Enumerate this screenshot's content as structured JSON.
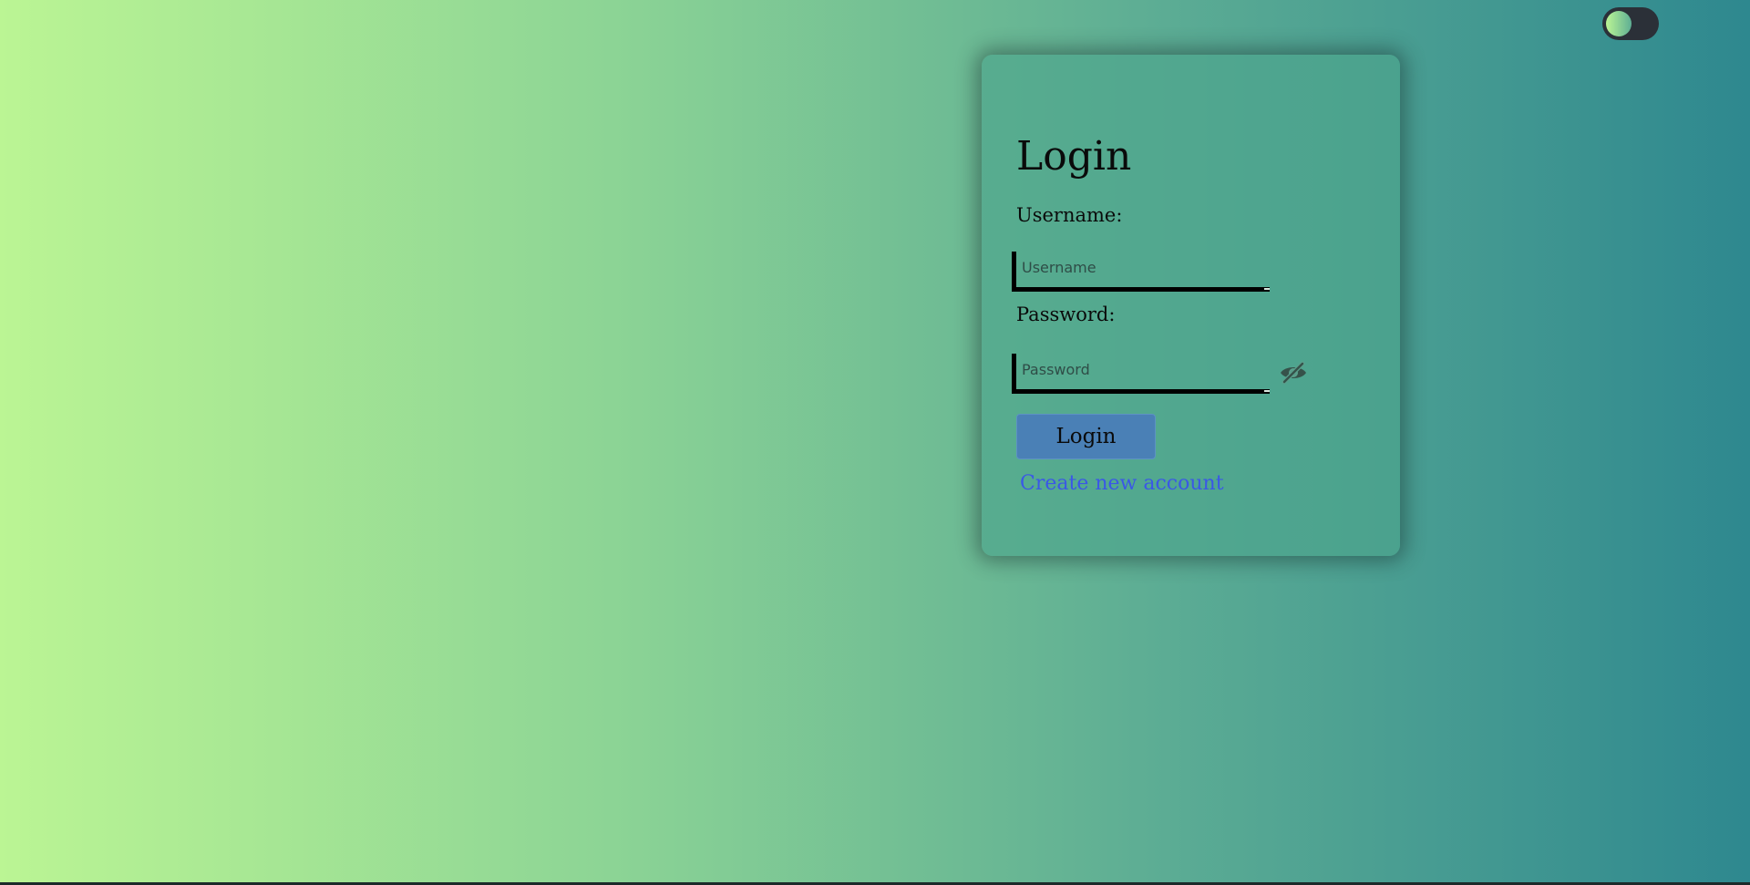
{
  "theme_toggle": {
    "state": "off",
    "track_color": "#2b3038"
  },
  "login_form": {
    "title": "Login",
    "username_label": "Username:",
    "username_value": "",
    "username_placeholder": "Username",
    "password_label": "Password:",
    "password_value": "",
    "password_placeholder": "Password",
    "password_visibility_icon": "eye-slash-icon",
    "submit_label": "Login",
    "create_account_label": "Create new account"
  },
  "colors": {
    "gradient_start": "#bbf594",
    "gradient_end": "#2e888f",
    "button": "#4a80b6",
    "link": "#3a58e6"
  }
}
